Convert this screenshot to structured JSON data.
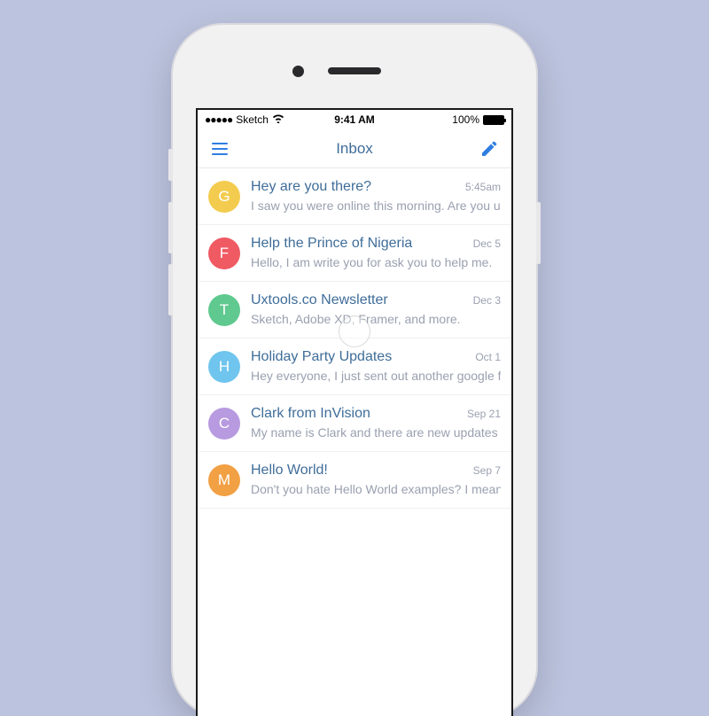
{
  "status": {
    "carrier": "Sketch",
    "signal_dots": "●●●●●",
    "wifi_glyph": "📶",
    "time": "9:41 AM",
    "battery_pct": "100%"
  },
  "navbar": {
    "title": "Inbox",
    "menu_icon": "hamburger-icon",
    "compose_icon": "compose-icon"
  },
  "messages": [
    {
      "initial": "G",
      "color": "#f3cc4f",
      "subject": "Hey are you there?",
      "preview": "I saw you were online this morning. Are you up a",
      "date": "5:45am"
    },
    {
      "initial": "F",
      "color": "#ef5a63",
      "subject": "Help the Prince of Nigeria",
      "preview": "Hello, I am write you for ask you to help me.",
      "date": "Dec 5"
    },
    {
      "initial": "T",
      "color": "#5fc98f",
      "subject": "Uxtools.co Newsletter",
      "preview": "Sketch, Adobe XD, Framer, and more.",
      "date": "Dec 3"
    },
    {
      "initial": "H",
      "color": "#6fc5ee",
      "subject": "Holiday Party Updates",
      "preview": "Hey everyone, I just sent out another google fon",
      "date": "Oct 1"
    },
    {
      "initial": "C",
      "color": "#b79ae0",
      "subject": "Clark from InVision",
      "preview": "My name is Clark and there are new updates to",
      "date": "Sep 21"
    },
    {
      "initial": "M",
      "color": "#f2a044",
      "subject": "Hello World!",
      "preview": "Don't you hate Hello World examples? I mean, g",
      "date": "Sep 7"
    }
  ]
}
